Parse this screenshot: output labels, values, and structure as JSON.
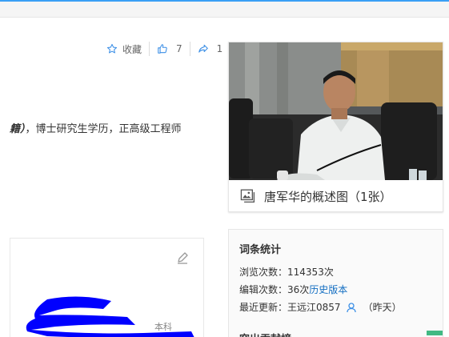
{
  "topbar": {
    "accent": "#3a9ff5"
  },
  "actions": {
    "favorite_label": "收藏",
    "like_count": "7",
    "share_count": "1",
    "icons": [
      "star-icon",
      "thumb-up-icon",
      "share-icon"
    ]
  },
  "summary": {
    "em_text": "籍）",
    "rest_text": "，博士研究生学历，正高级工程师"
  },
  "album": {
    "caption": "唐军华的概述图（1张）",
    "icon": "image-gallery-icon"
  },
  "left_card": {
    "icon": "pencil-icon",
    "ghost_text": "本科"
  },
  "stats": {
    "title": "词条统计",
    "views_label": "浏览次数：",
    "views_value": "114353次",
    "edits_label": "编辑次数：",
    "edits_value": "36次",
    "history_link": "历史版本",
    "updated_label": "最近更新：",
    "updated_user": "王远江0857",
    "updated_when": "（昨天）",
    "sub_title": "突出贡献榜",
    "link_color": "#136ec2"
  }
}
